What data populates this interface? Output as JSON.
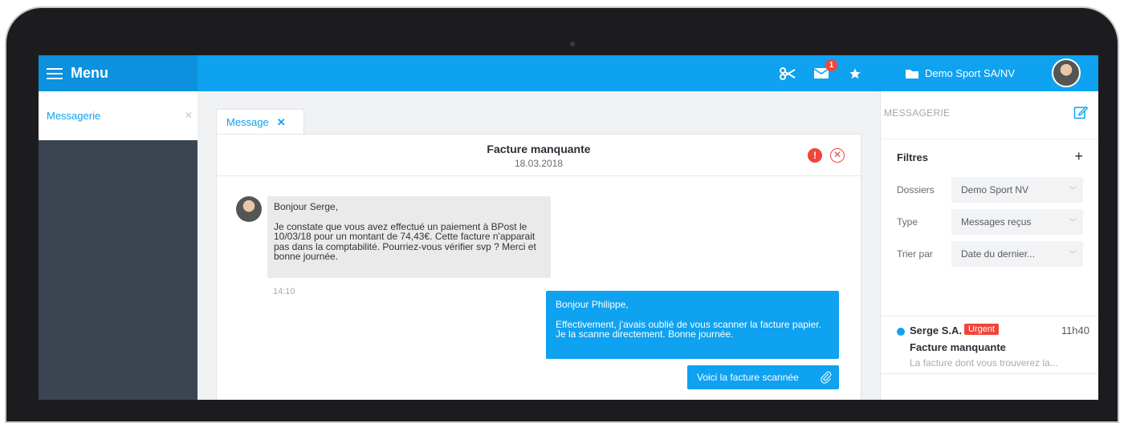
{
  "menu": {
    "label": "Menu"
  },
  "topbar": {
    "notification_count": "1",
    "company": "Demo Sport SA/NV"
  },
  "sidebar": {
    "items": [
      {
        "label": "Messagerie"
      }
    ]
  },
  "tabs": [
    {
      "label": "Message"
    }
  ],
  "message": {
    "title": "Facture manquante",
    "date": "18.03.2018",
    "incoming": {
      "greeting": "Bonjour Serge,",
      "body": "Je constate que vous avez effectué un paiement à BPost le 10/03/18 pour un montant de 74,43€. Cette facture n'apparait pas dans la comptabilité. Pourriez-vous vérifier svp ? Merci et bonne journée.",
      "time": "14:10"
    },
    "outgoing": {
      "greeting": "Bonjour Philippe,",
      "body": "Effectivement, j'avais oublié de vous scanner la facture papier. Je la scanne directement. Bonne journée."
    },
    "attachment": {
      "label": "Voici la facture scannée"
    }
  },
  "rightpanel": {
    "heading": "MESSAGERIE",
    "filters_title": "Filtres",
    "filters_add": "+",
    "filters": [
      {
        "label": "Dossiers",
        "value": "Demo Sport NV"
      },
      {
        "label": "Type",
        "value": "Messages reçus"
      },
      {
        "label": "Trier par",
        "value": "Date du dernier..."
      }
    ],
    "conversation": {
      "sender": "Serge S.A.",
      "tag": "Urgent",
      "time": "11h40",
      "subject": "Facture manquante",
      "preview": "La facture dont vous trouverez la..."
    }
  },
  "colors": {
    "accent": "#0ea2f0",
    "sidebar": "#3b4552",
    "danger": "#f0453a"
  }
}
